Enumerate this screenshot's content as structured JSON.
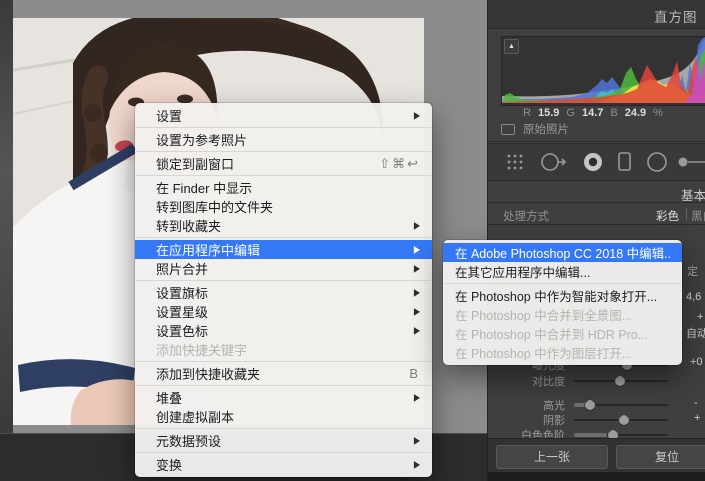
{
  "glyphs": {
    "submenu_arrow": "▶",
    "clipping_triangle": "▲"
  },
  "photo": {
    "description": "portrait of a girl with braided hair in a white top with navy trim"
  },
  "context_menu": {
    "items": [
      {
        "label": "设置",
        "arrow": true
      },
      {
        "label": "设置为参考照片"
      },
      {
        "label": "锁定到副窗口",
        "shortcut": "⇧⌘↩"
      },
      {
        "label": "在 Finder 中显示"
      },
      {
        "label": "转到图库中的文件夹"
      },
      {
        "label": "转到收藏夹",
        "arrow": true
      },
      {
        "label": "在应用程序中编辑",
        "arrow": true,
        "selected": true
      },
      {
        "label": "照片合并",
        "arrow": true
      },
      {
        "label": "设置旗标",
        "arrow": true
      },
      {
        "label": "设置星级",
        "arrow": true
      },
      {
        "label": "设置色标",
        "arrow": true
      },
      {
        "label": "添加快捷关键字",
        "disabled": true
      },
      {
        "label": "添加到快捷收藏夹",
        "shortcut": "B"
      },
      {
        "label": "堆叠",
        "arrow": true
      },
      {
        "label": "创建虚拟副本"
      },
      {
        "label": "元数据预设",
        "arrow": true
      },
      {
        "label": "变换",
        "arrow": true
      }
    ]
  },
  "submenu": {
    "items": [
      {
        "label": "在 Adobe Photoshop CC 2018 中编辑...",
        "selected": true
      },
      {
        "label": "在其它应用程序中编辑..."
      },
      {
        "label": "在 Photoshop 中作为智能对象打开..."
      },
      {
        "label": "在 Photoshop 中合并到全景图...",
        "disabled": true
      },
      {
        "label": "在 Photoshop 中合并到 HDR Pro...",
        "disabled": true
      },
      {
        "label": "在 Photoshop 中作为图层打开...",
        "disabled": true
      }
    ]
  },
  "right_panel": {
    "histogram_title": "直方图",
    "rgb_readout": {
      "r_label": "R",
      "r_value": "15.9",
      "g_label": "G",
      "g_value": "14.7",
      "b_label": "B",
      "b_value": "24.9",
      "percent": "%"
    },
    "original_photo_label": "原始照片",
    "basic_section_title": "基本",
    "treatment": {
      "label": "处理方式",
      "selected": "彩色",
      "divider": "|",
      "alternate": "黑白"
    },
    "fragments": {
      "wb": "定",
      "temp_value": "4,6",
      "tint_value": "+",
      "auto_button": "自动",
      "exposure_value": "+0",
      "highlights_value": "-",
      "shadows_value": "+"
    },
    "sliders": [
      {
        "label": "曝光度",
        "thumb_pct": 55
      },
      {
        "label": "对比度",
        "thumb_pct": 48
      },
      {
        "label": "高光",
        "thumb_pct": 16
      },
      {
        "label": "阴影",
        "thumb_pct": 52
      },
      {
        "label": "白色色阶",
        "thumb_pct": 40
      }
    ],
    "footer_buttons": {
      "previous": "上一张",
      "reset": "复位"
    }
  },
  "colors": {
    "menu_highlight": "#3478f6",
    "panel_bg": "#3f3f3f",
    "histogram": {
      "red": "#e04438",
      "green": "#4fb83c",
      "blue": "#4f74d8",
      "yellow": "#f0e63e",
      "magenta": "#c44fd0",
      "cyan": "#3fc4c4",
      "gray": "#b2b2b2"
    }
  }
}
